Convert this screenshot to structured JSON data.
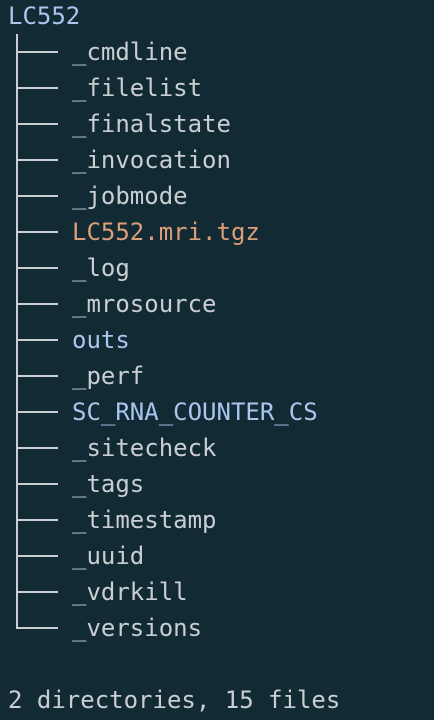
{
  "colors": {
    "background": "#122a33",
    "text": "#c8ced2",
    "directory": "#a8c6ee",
    "archive": "#dc9e78"
  },
  "tree": {
    "root": "LC552",
    "entries": [
      {
        "name": "_cmdline",
        "kind": "file"
      },
      {
        "name": "_filelist",
        "kind": "file"
      },
      {
        "name": "_finalstate",
        "kind": "file"
      },
      {
        "name": "_invocation",
        "kind": "file"
      },
      {
        "name": "_jobmode",
        "kind": "file"
      },
      {
        "name": "LC552.mri.tgz",
        "kind": "archive"
      },
      {
        "name": "_log",
        "kind": "file"
      },
      {
        "name": "_mrosource",
        "kind": "file"
      },
      {
        "name": "outs",
        "kind": "directory"
      },
      {
        "name": "_perf",
        "kind": "file"
      },
      {
        "name": "SC_RNA_COUNTER_CS",
        "kind": "directory"
      },
      {
        "name": "_sitecheck",
        "kind": "file"
      },
      {
        "name": "_tags",
        "kind": "file"
      },
      {
        "name": "_timestamp",
        "kind": "file"
      },
      {
        "name": "_uuid",
        "kind": "file"
      },
      {
        "name": "_vdrkill",
        "kind": "file"
      },
      {
        "name": "_versions",
        "kind": "file"
      }
    ]
  },
  "summary": "2 directories, 15 files"
}
